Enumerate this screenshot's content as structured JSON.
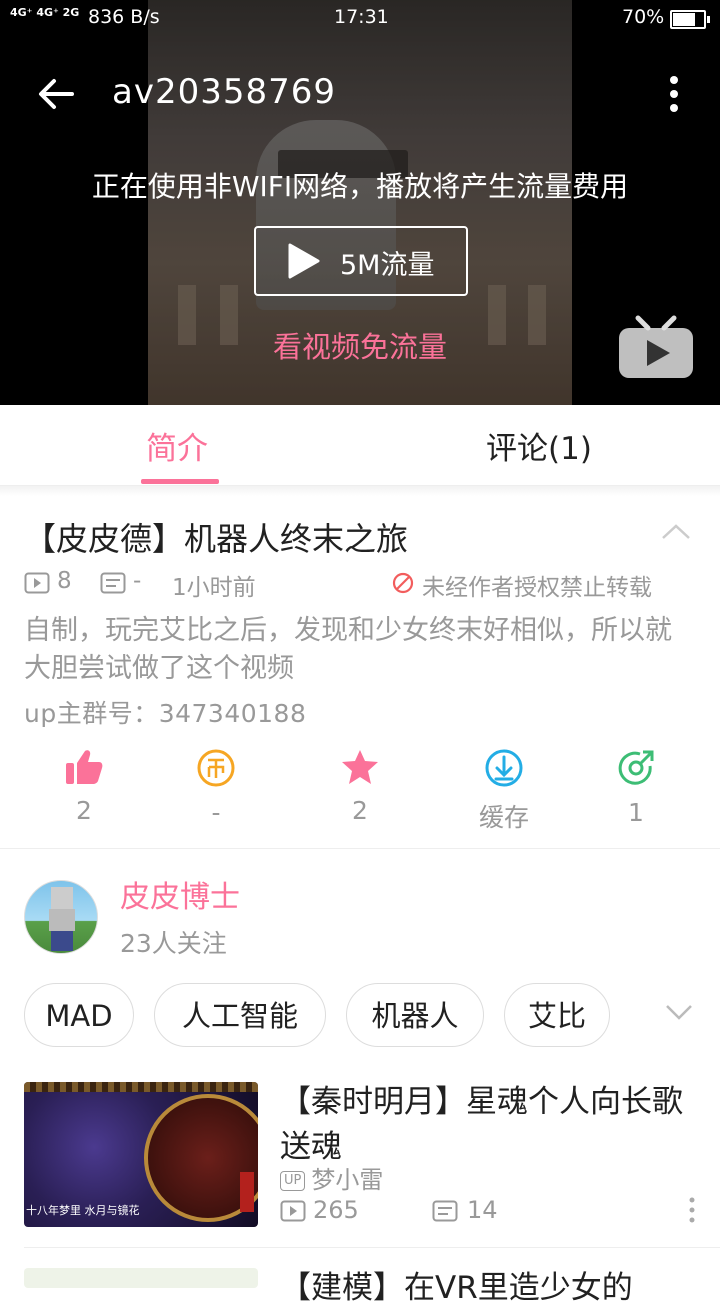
{
  "status_bar": {
    "signal": "4G⁺ 4G⁺ 2G",
    "speed": "836 B/s",
    "time": "17:31",
    "battery": "70%"
  },
  "player": {
    "title": "av20358769",
    "network_warning": "正在使用非WIFI网络，播放将产生流量费用",
    "play_label": "5M流量",
    "free_data": "看视频免流量"
  },
  "tabs": [
    {
      "label": "简介",
      "active": true
    },
    {
      "label": "评论(1)",
      "active": false
    }
  ],
  "video": {
    "title": "【皮皮德】机器人终末之旅",
    "views": "8",
    "danmaku": "-",
    "posted": "1小时前",
    "no_repost": "未经作者授权禁止转载",
    "description": "自制，玩完艾比之后，发现和少女终末好相似，所以就大胆尝试做了这个视频",
    "group": "up主群号：347340188"
  },
  "actions": [
    {
      "icon": "like-icon",
      "value": "2"
    },
    {
      "icon": "coin-icon",
      "value": "-"
    },
    {
      "icon": "star-icon",
      "value": "2"
    },
    {
      "icon": "download-icon",
      "value": "缓存"
    },
    {
      "icon": "share-icon",
      "value": "1"
    }
  ],
  "uploader": {
    "name": "皮皮博士",
    "followers": "23人关注"
  },
  "tags": [
    "MAD",
    "人工智能",
    "机器人",
    "艾比"
  ],
  "recommendations": [
    {
      "title": "【秦时明月】星魂个人向长歌送魂",
      "up_badge": "UP",
      "up": "梦小雷",
      "views": "265",
      "danmaku": "14",
      "thumb_caption": "十八年梦里  水月与镜花"
    },
    {
      "title": "【建模】在VR里造少女的"
    }
  ],
  "colors": {
    "accent": "#fb7299",
    "action_blue": "#23ade5",
    "action_orange": "#f6a623",
    "action_green": "#3dbd75"
  }
}
